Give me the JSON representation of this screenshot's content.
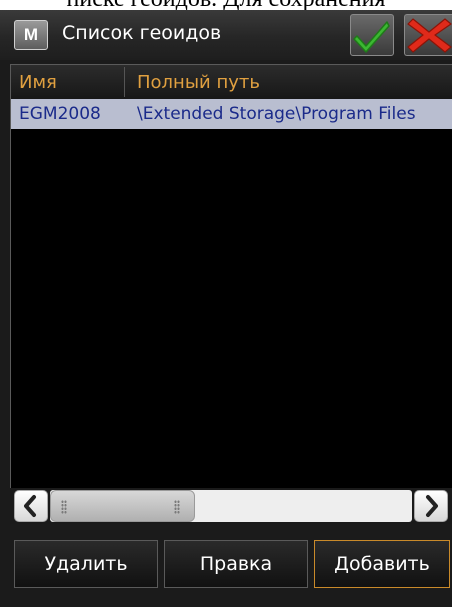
{
  "document": {
    "top_text": "писке геоидов. Для сохранения"
  },
  "window": {
    "title": "Список геоидов",
    "app_icon": "M",
    "ok_icon": "green-checkmark-icon",
    "cancel_icon": "red-x-icon"
  },
  "table": {
    "columns": [
      "Имя",
      "Полный путь"
    ],
    "rows": [
      {
        "name": "EGM2008",
        "path": "\\Extended Storage\\Program Files"
      }
    ]
  },
  "scrollbar": {
    "position": 0,
    "visible_fraction": 0.4
  },
  "buttons": {
    "delete": "Удалить",
    "edit": "Правка",
    "add": "Добавить"
  },
  "colors": {
    "header_text": "#e0a040",
    "selected_row_bg": "#b9bed0",
    "selected_row_text": "#1a2a8a",
    "active_button_border": "#c98a2a",
    "ok_green": "#3cb832",
    "cancel_red": "#e02a1a"
  }
}
